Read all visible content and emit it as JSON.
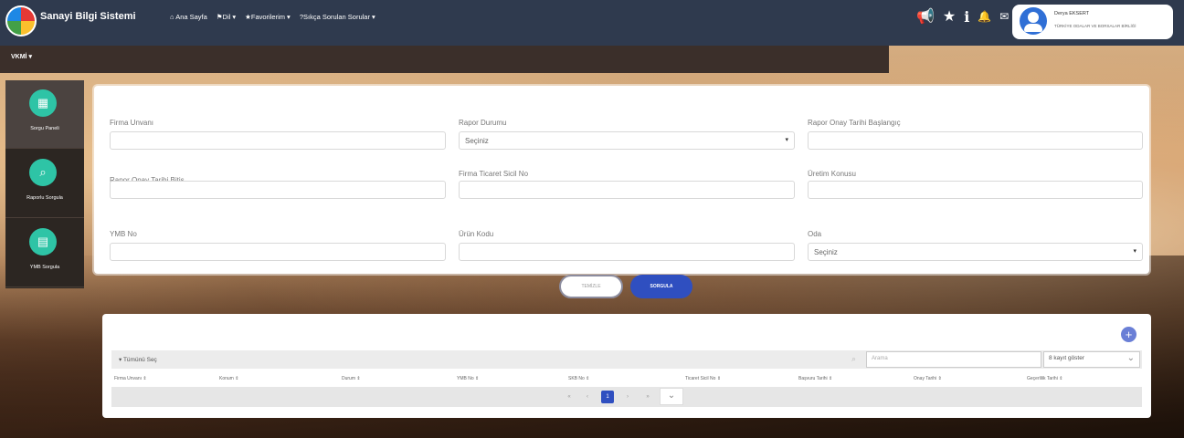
{
  "header": {
    "app_title": "Sanayi Bilgi Sistemi",
    "nav": [
      {
        "icon": "home-icon",
        "label": "Ana Sayfa"
      },
      {
        "icon": "flag-icon",
        "label": "Dil ▾"
      },
      {
        "icon": "star-icon",
        "label": "Favorilerim ▾"
      },
      {
        "icon": "question-icon",
        "label": "Sıkça Sorulan Sorular ▾"
      }
    ],
    "top_icons": [
      "megaphone-icon",
      "star-icon",
      "info-icon",
      "bell-icon",
      "envelope-icon"
    ],
    "user": {
      "name": "Derya EKSERT",
      "org": "TÜRKİYE ODALAR VE BORSALAR BİRLİĞİ"
    }
  },
  "subbar": {
    "label": "VKMİ ▾"
  },
  "sidebar": {
    "items": [
      {
        "label": "Sorgu Paneli",
        "icon": "calendar-icon",
        "active": true
      },
      {
        "label": "Raporlu Sorgula",
        "icon": "search-icon",
        "active": false
      },
      {
        "label": "YMB Sorgula",
        "icon": "document-icon",
        "active": false
      }
    ]
  },
  "filters": {
    "firma_unvani": {
      "label": "Firma Unvanı",
      "value": ""
    },
    "rapor_durumu": {
      "label": "Rapor Durumu",
      "value": "Seçiniz"
    },
    "rapor_onay_baslangic": {
      "label": "Rapor Onay Tarihi Başlangıç",
      "value": ""
    },
    "rapor_onay_bitis": {
      "label": "Rapor Onay Tarihi Bitiş",
      "value": ""
    },
    "firma_ticaret_sicil": {
      "label": "Firma Ticaret Sicil No",
      "value": ""
    },
    "uretim_konusu": {
      "label": "Üretim Konusu",
      "value": ""
    },
    "ymb_no": {
      "label": "YMB No",
      "value": ""
    },
    "urun_kodu": {
      "label": "Ürün Kodu",
      "value": ""
    },
    "oda": {
      "label": "Oda",
      "value": "Seçiniz"
    }
  },
  "buttons": {
    "clear": "TEMİZLE",
    "query": "SORGULA"
  },
  "table": {
    "toggle_label": "▾ Tümünü Seç",
    "search_placeholder": "Arama",
    "page_size": "8 kayıt göster",
    "columns": [
      "Firma Unvanı ⇕",
      "Konum ⇕",
      "Durum ⇕",
      "YMB No ⇕",
      "SKB No ⇕",
      "Ticaret Sicil No ⇕",
      "Başvuru Tarihi ⇕",
      "Onay Tarihi ⇕",
      "Geçerlilik Tarihi ⇕"
    ],
    "pagination": {
      "first": "«",
      "prev": "‹",
      "current": "1",
      "next": "›",
      "last": "»"
    }
  }
}
